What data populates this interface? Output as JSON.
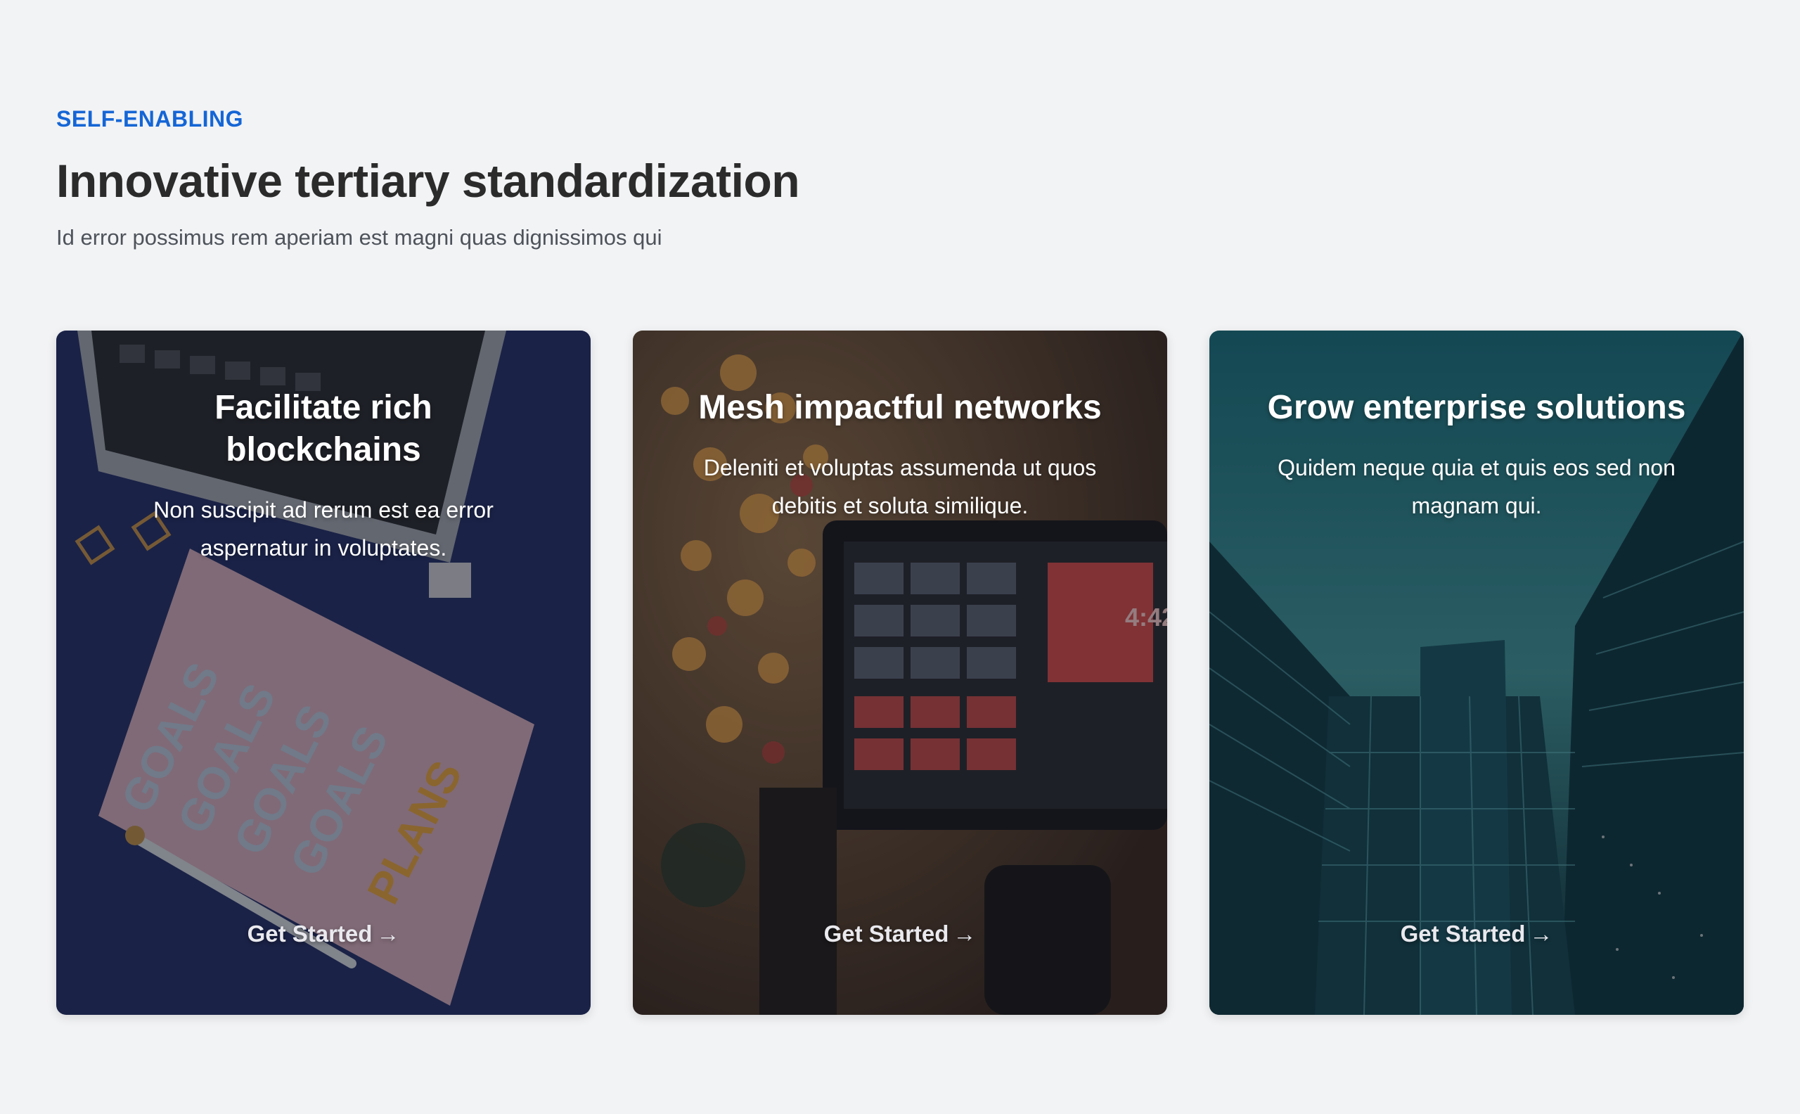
{
  "section": {
    "eyebrow": "SELF-ENABLING",
    "heading": "Innovative tertiary standardization",
    "subtext": "Id error possimus rem aperiam est magni quas dignissimos qui"
  },
  "cards": [
    {
      "title": "Facilitate rich blockchains",
      "description": "Non suscipit ad rerum est ea error aspernatur in voluptates.",
      "cta": "Get Started",
      "cta_arrow": "→",
      "image": "desk-notebook-goals-photo"
    },
    {
      "title": "Mesh impactful networks",
      "description": "Deleniti et voluptas assumenda ut quos debitis et soluta similique.",
      "cta": "Get Started",
      "cta_arrow": "→",
      "image": "camera-monitor-bokeh-photo"
    },
    {
      "title": "Grow enterprise solutions",
      "description": "Quidem neque quia et quis eos sed non magnam qui.",
      "cta": "Get Started",
      "cta_arrow": "→",
      "image": "glass-office-buildings-photo"
    }
  ],
  "colors": {
    "page_background": "#f2f3f5",
    "accent": "#1566d6",
    "heading": "#2b2b2b",
    "body_text": "#4e535b"
  }
}
